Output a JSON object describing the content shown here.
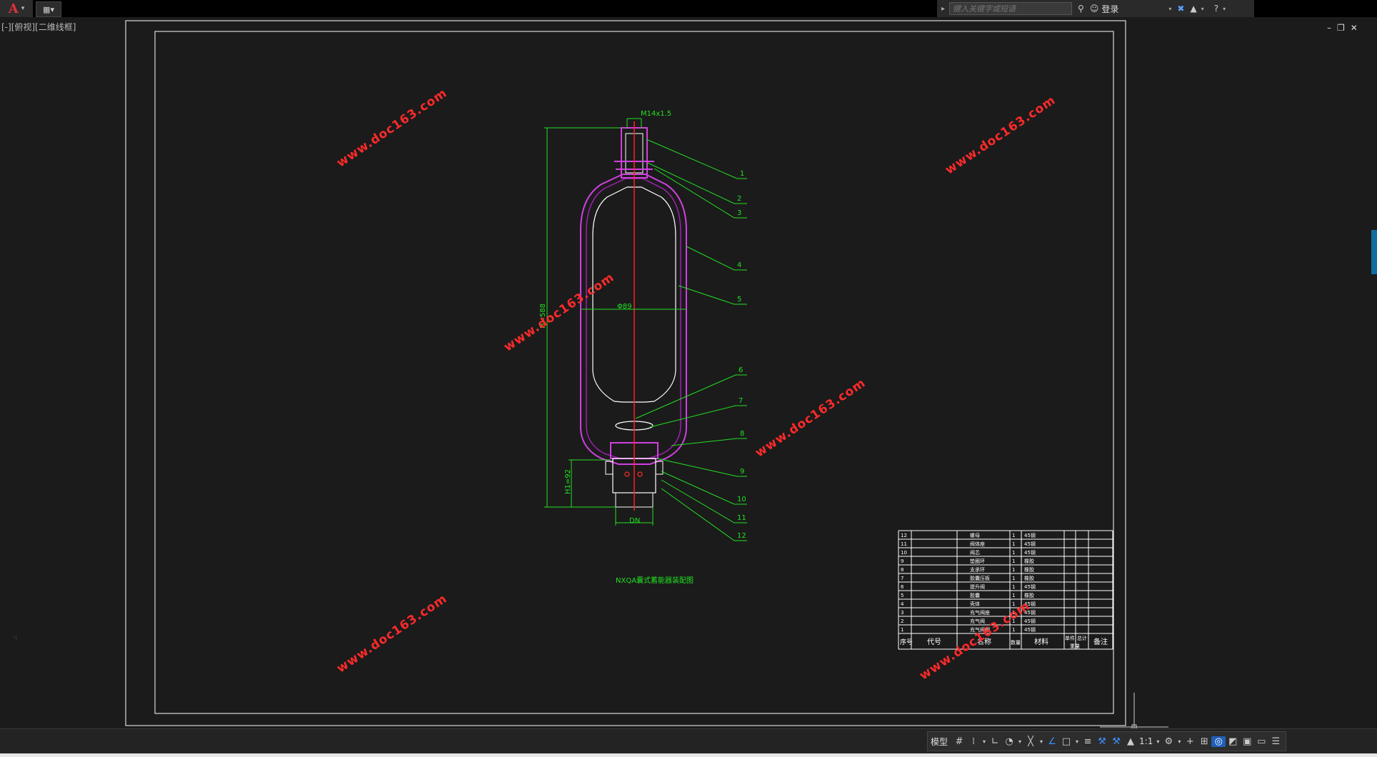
{
  "app": {
    "title_menu": "▾",
    "search": {
      "placeholder": "键入关键字或短语"
    },
    "login": "登录",
    "help": "?"
  },
  "viewport": {
    "label": "[-][俯视][二维线框]"
  },
  "window_controls": {
    "minimize": "–",
    "restore": "❐",
    "close": "✕"
  },
  "drawing": {
    "dim_top": "M14x1.5",
    "dim_diameter": "Φ89",
    "dim_height": "H=588",
    "dim_h1": "H1=92",
    "dim_bottom": "DN",
    "balloons": [
      "1",
      "2",
      "3",
      "4",
      "5",
      "6",
      "7",
      "8",
      "9",
      "10",
      "11",
      "12"
    ],
    "caption": "NXQA囊式蓄能器装配图",
    "watermark": "www.doc163.com"
  },
  "parts_table": {
    "rows": [
      {
        "no": "12",
        "name": "螺母",
        "qty": "1",
        "mat": "45钢"
      },
      {
        "no": "11",
        "name": "阀体座",
        "qty": "1",
        "mat": "45钢"
      },
      {
        "no": "10",
        "name": "阀芯",
        "qty": "1",
        "mat": "45钢"
      },
      {
        "no": "9",
        "name": "垫圈环",
        "qty": "1",
        "mat": "橡胶"
      },
      {
        "no": "8",
        "name": "支承环",
        "qty": "1",
        "mat": "橡胶"
      },
      {
        "no": "7",
        "name": "胶囊压板",
        "qty": "1",
        "mat": "橡胶"
      },
      {
        "no": "6",
        "name": "提升阀",
        "qty": "1",
        "mat": "45钢"
      },
      {
        "no": "5",
        "name": "胶囊",
        "qty": "1",
        "mat": "橡胶"
      },
      {
        "no": "4",
        "name": "壳体",
        "qty": "1",
        "mat": "45钢"
      },
      {
        "no": "3",
        "name": "充气阀座",
        "qty": "1",
        "mat": "45钢"
      },
      {
        "no": "2",
        "name": "充气阀",
        "qty": "1",
        "mat": "45钢"
      },
      {
        "no": "1",
        "name": "充气阀帽",
        "qty": "1",
        "mat": "45钢"
      }
    ],
    "header": {
      "no": "序号",
      "code": "代号",
      "name": "名称",
      "qty": "数量",
      "mat": "材料",
      "weight_single": "单件",
      "weight_total": "总计",
      "weight": "重量",
      "note": "备注"
    }
  },
  "statusbar": {
    "model": "模型",
    "scale": "1:1"
  },
  "colors": {
    "frame": "#ffffff",
    "green": "#22e022",
    "magenta": "#d040e0",
    "red": "#ff2020"
  }
}
